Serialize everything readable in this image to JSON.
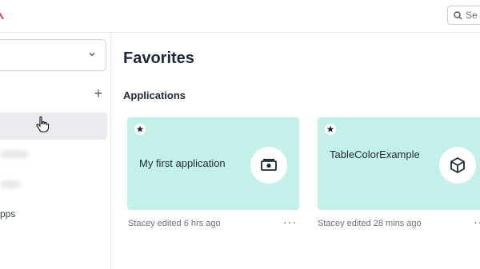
{
  "header": {
    "search_placeholder": "Se"
  },
  "sidebar": {
    "add_label": "+",
    "items": [
      {
        "label": ""
      },
      {
        "label": ""
      },
      {
        "label": ""
      },
      {
        "label": "pps"
      }
    ]
  },
  "main": {
    "page_title": "Favorites",
    "section_title": "Applications",
    "apps": [
      {
        "name": "My first application",
        "edited": "Stacey edited 6 hrs ago",
        "more": "···",
        "icon": "money-icon"
      },
      {
        "name": "TableColorExample",
        "edited": "Stacey edited 28 mins ago",
        "more": "···",
        "icon": "cube-icon"
      }
    ]
  },
  "colors": {
    "card_bg": "#c4f0ea",
    "accent": "#e0404b"
  }
}
